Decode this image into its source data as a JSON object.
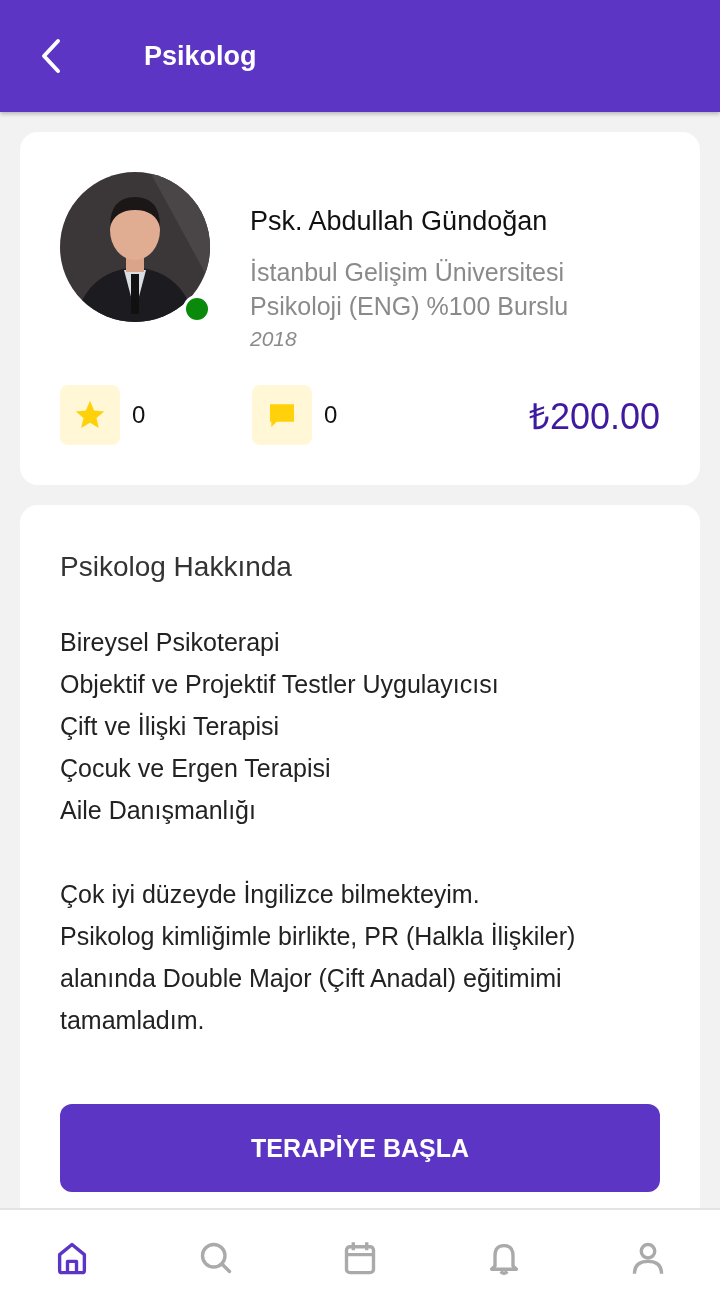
{
  "header": {
    "title": "Psikolog"
  },
  "profile": {
    "name": "Psk. Abdullah Gündoğan",
    "education": [
      "İstanbul Gelişim Üniversitesi",
      "Psikoloji (ENG)  %100 Burslu"
    ],
    "year": "2018",
    "online": true,
    "rating_count": "0",
    "comment_count": "0",
    "price": "₺200.00"
  },
  "about": {
    "title": "Psikolog Hakkında",
    "paragraphs": [
      [
        "Bireysel Psikoterapi",
        "Objektif ve Projektif Testler Uygulayıcısı",
        "Çift ve İlişki Terapisi",
        "Çocuk ve Ergen Terapisi",
        "Aile Danışmanlığı"
      ],
      [
        "Çok iyi düzeyde İngilizce bilmekteyim.",
        "Psikolog kimliğimle birlikte, PR (Halkla İlişkiler)",
        "alanında Double Major (Çift Anadal) eğitimimi",
        "tamamladım."
      ]
    ]
  },
  "action_button": {
    "label": "TERAPİYE BAŞLA"
  },
  "nav": [
    {
      "kind": "home",
      "selected": true
    },
    {
      "kind": "search",
      "selected": false
    },
    {
      "kind": "calendar",
      "selected": false
    },
    {
      "kind": "bell",
      "selected": false
    },
    {
      "kind": "profile",
      "selected": false
    }
  ]
}
